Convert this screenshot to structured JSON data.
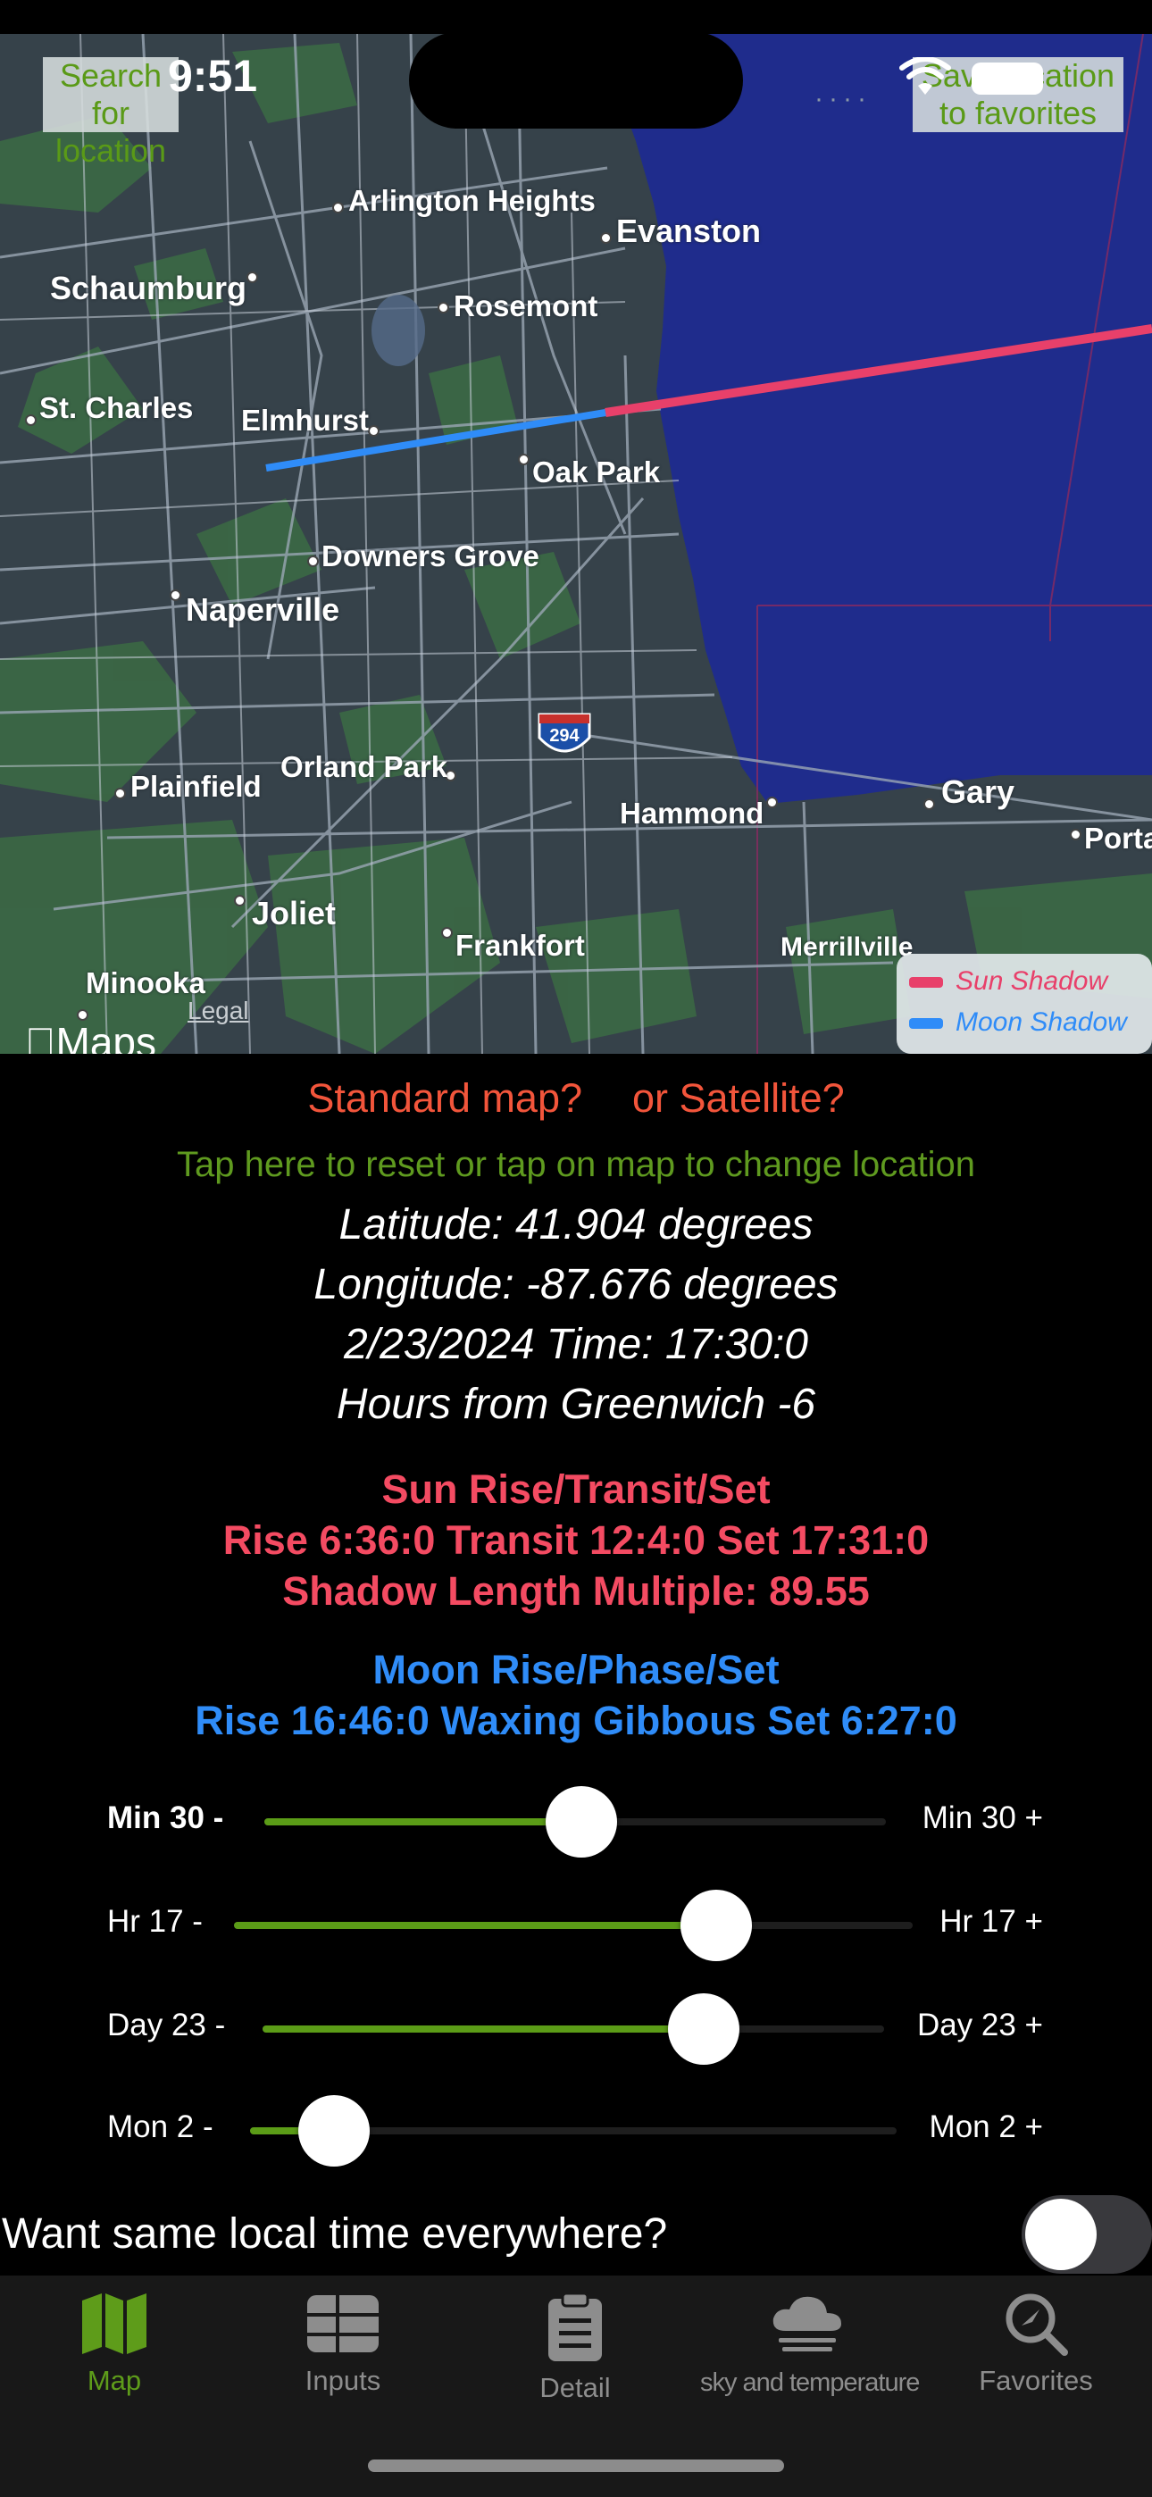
{
  "status_bar": {
    "time": "9:51",
    "dots": "····"
  },
  "map": {
    "search_button": "Search\nfor location",
    "favorite_button": "Save location\nto favorites",
    "cities": [
      "Arlington Heights",
      "Evanston",
      "Schaumburg",
      "Rosemont",
      "St. Charles",
      "Elmhurst",
      "Oak Park",
      "Downers Grove",
      "Naperville",
      "Orland Park",
      "Plainfield",
      "Hammond",
      "Gary",
      "Portage",
      "Joliet",
      "Frankfort",
      "Merrillville",
      "Minooka"
    ],
    "interstate": "294",
    "attribution": "Maps",
    "legal": "Legal",
    "legend": {
      "sun": "Sun Shadow",
      "moon": "Moon Shadow"
    },
    "colors": {
      "sun_line": "#e8406a",
      "moon_line": "#2f8cf8",
      "lake": "#1f2c8c"
    }
  },
  "map_type": {
    "standard": "Standard map?",
    "satellite": "or Satellite?"
  },
  "reset_hint": "Tap here to reset or tap on map to change location",
  "location": {
    "latitude": "Latitude: 41.904 degrees",
    "longitude": "Longitude: -87.676 degrees",
    "datetime": "2/23/2024 Time: 17:30:0",
    "gmt_offset": "Hours from Greenwich -6"
  },
  "sun": {
    "header": "Sun Rise/Transit/Set",
    "times": "Rise 6:36:0  Transit 12:4:0  Set 17:31:0",
    "shadow": "Shadow Length Multiple: 89.55"
  },
  "moon": {
    "header": "Moon Rise/Phase/Set",
    "times": "Rise 16:46:0  Waxing Gibbous Set 6:27:0"
  },
  "sliders": [
    {
      "minus": "Min 30 -",
      "plus": "Min 30 +",
      "level": 0.51
    },
    {
      "minus": "Hr 17 -",
      "plus": "Hr 17 +",
      "level": 0.71
    },
    {
      "minus": "Day 23 -",
      "plus": "Day 23 +",
      "level": 0.71
    },
    {
      "minus": "Mon 2 -",
      "plus": "Mon 2 +",
      "level": 0.13
    }
  ],
  "same_time_toggle": {
    "label": "Want same local time everywhere?",
    "on": false
  },
  "tabs": [
    {
      "label": "Map",
      "icon": "map-icon",
      "active": true
    },
    {
      "label": "Inputs",
      "icon": "table-icon",
      "active": false
    },
    {
      "label": "Detail",
      "icon": "clipboard-icon",
      "active": false
    },
    {
      "label": "sky and temperature",
      "icon": "cloud-icon",
      "active": false
    },
    {
      "label": "Favorites",
      "icon": "magnifier-icon",
      "active": false
    }
  ]
}
